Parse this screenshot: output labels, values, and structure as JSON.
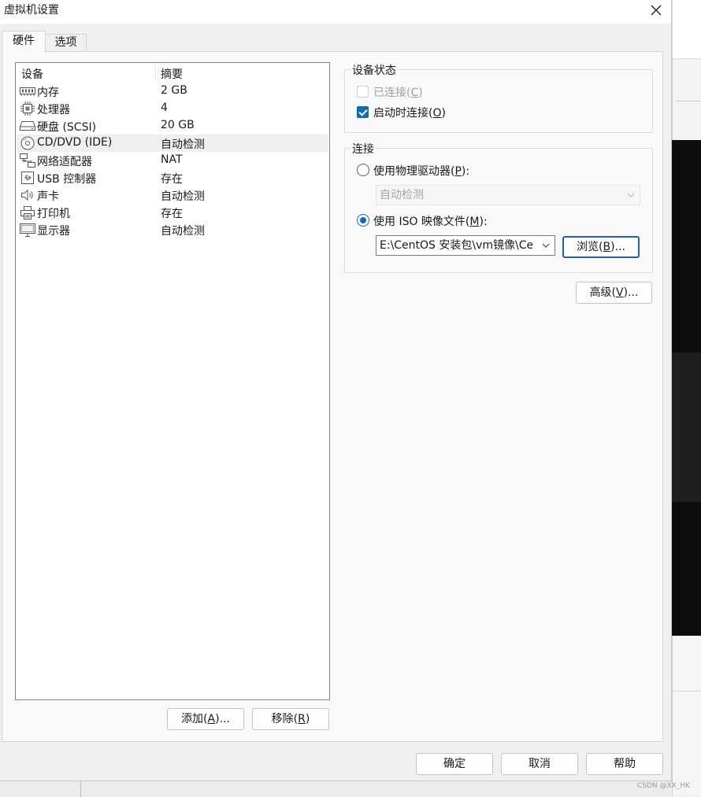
{
  "window": {
    "title": "虚拟机设置"
  },
  "tabs": [
    {
      "label": "硬件"
    },
    {
      "label": "选项"
    }
  ],
  "device_list": {
    "headers": {
      "device": "设备",
      "summary": "摘要"
    },
    "rows": [
      {
        "name": "内存",
        "summary": "2 GB",
        "icon": "memory-icon"
      },
      {
        "name": "处理器",
        "summary": "4",
        "icon": "processor-icon"
      },
      {
        "name": "硬盘 (SCSI)",
        "summary": "20 GB",
        "icon": "hard-disk-icon"
      },
      {
        "name": "CD/DVD (IDE)",
        "summary": "自动检测",
        "icon": "cd-dvd-icon"
      },
      {
        "name": "网络适配器",
        "summary": "NAT",
        "icon": "network-adapter-icon"
      },
      {
        "name": "USB 控制器",
        "summary": "存在",
        "icon": "usb-controller-icon"
      },
      {
        "name": "声卡",
        "summary": "自动检测",
        "icon": "sound-card-icon"
      },
      {
        "name": "打印机",
        "summary": "存在",
        "icon": "printer-icon"
      },
      {
        "name": "显示器",
        "summary": "自动检测",
        "icon": "display-icon"
      }
    ],
    "selected": "CD/DVD (IDE)"
  },
  "list_buttons": {
    "add": {
      "text": "添加(",
      "key": "A",
      "suffix": ")..."
    },
    "remove": {
      "text": "移除(",
      "key": "R",
      "suffix": ")"
    }
  },
  "device_status": {
    "title": "设备状态",
    "connected": {
      "text": "已连接(",
      "key": "C",
      "suffix": ")",
      "checked": false,
      "enabled": false
    },
    "connect_on_power": {
      "text": "启动时连接(",
      "key": "O",
      "suffix": ")",
      "checked": true,
      "enabled": true
    }
  },
  "connection": {
    "title": "连接",
    "physical_drive": {
      "text": "使用物理驱动器(",
      "key": "P",
      "suffix": "):",
      "selected": false
    },
    "physical_drive_value": "自动检测",
    "iso": {
      "text": "使用 ISO 映像文件(",
      "key": "M",
      "suffix": "):",
      "selected": true
    },
    "iso_path": "E:\\CentOS 安装包\\vm镜像\\Ce",
    "browse": {
      "text": "浏览(",
      "key": "B",
      "suffix": ")..."
    }
  },
  "advanced": {
    "text": "高级(",
    "key": "V",
    "suffix": ")..."
  },
  "footer_buttons": {
    "ok": "确定",
    "cancel": "取消",
    "help": "帮助"
  },
  "watermark": "CSDN @XX_HK",
  "colors": {
    "accent": "#0f6cbd",
    "selected_row": "#efefef",
    "focus_border": "#1f5fbf"
  }
}
